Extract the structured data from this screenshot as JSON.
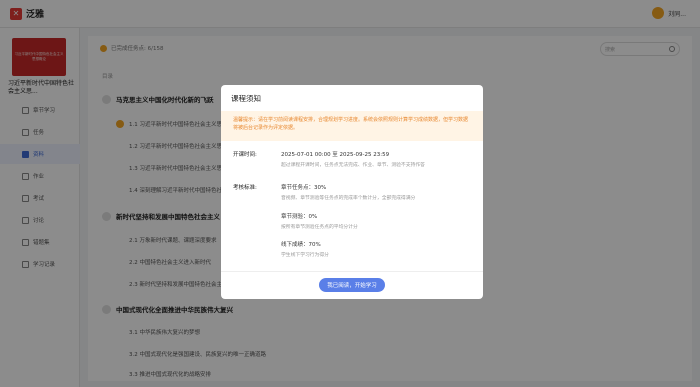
{
  "app": {
    "logo_text": "泛雅"
  },
  "header": {
    "user_name": "刘同..."
  },
  "sidebar": {
    "cover_text": "习近平新时代中国特色社会主义思想概论",
    "course_title": "习近平新时代中国特色社会主义思...",
    "items": [
      {
        "label": "章节学习"
      },
      {
        "label": "任务"
      },
      {
        "label": "资料"
      },
      {
        "label": "作业"
      },
      {
        "label": "考试"
      },
      {
        "label": "讨论"
      },
      {
        "label": "错题集"
      },
      {
        "label": "学习记录"
      }
    ]
  },
  "main": {
    "progress_text": "已完成任务点: 6/158",
    "search_placeholder": "搜索",
    "list_label": "目录",
    "chapters": [
      {
        "title": "马克思主义中国化时代化新的飞跃"
      },
      {
        "title": "新时代坚持和发展中国特色社会主义"
      },
      {
        "title": "中国式现代化全面推进中华民族伟大复兴"
      }
    ],
    "sections": [
      "1.1 习近平新时代中国特色社会主义思想创立的时代背景",
      "1.2 习近平新时代中国特色社会主义思想的核心要义",
      "1.3 习近平新时代中国特色社会主义思想的历史地位",
      "1.4 深刻理解习近平新时代中国特色社会主义思想",
      "2.1 万象新时代课题、课题深度要求",
      "2.2 中国特色社会主义进入新时代",
      "2.3 新时代坚持和发展中国特色社会主义",
      "3.1 中华民族伟大复兴的梦想",
      "3.2 中国式现代化是强国建设、民族复兴的唯一正确道路",
      "3.3 推进中国式现代化的战略安排"
    ]
  },
  "modal": {
    "title": "课程须知",
    "notice": "温馨提示：请在学习前阅读课程安排，合理规划学习进度。系统会依照规则计算学习成绩数据，但学习数据将被后台记录作为评定依据。",
    "schedule_label": "开课时间:",
    "schedule_value": "2025-07-01 00:00 至 2025-09-25 23:59",
    "schedule_desc": "超过课程开课时间，任务点无法完成、作业、章节、测验不支持作答",
    "assessment_label": "考核标准:",
    "criteria": [
      {
        "value": "章节任务点：30%",
        "desc": "音视频、章节测验等任务点的完成率个数计分，全部完成得满分"
      },
      {
        "value": "章节测验：0%",
        "desc": "按所有章节测验任务点的平均分计分"
      },
      {
        "value": "线下成绩：70%",
        "desc": "学生线下学习行为得分"
      }
    ],
    "start_button": "我已阅读，开始学习"
  },
  "colors": {
    "accent": "#5a7fe8",
    "notice_text": "#e8872e",
    "notice_bg": "#fff4e5",
    "logo": "#e53935"
  }
}
